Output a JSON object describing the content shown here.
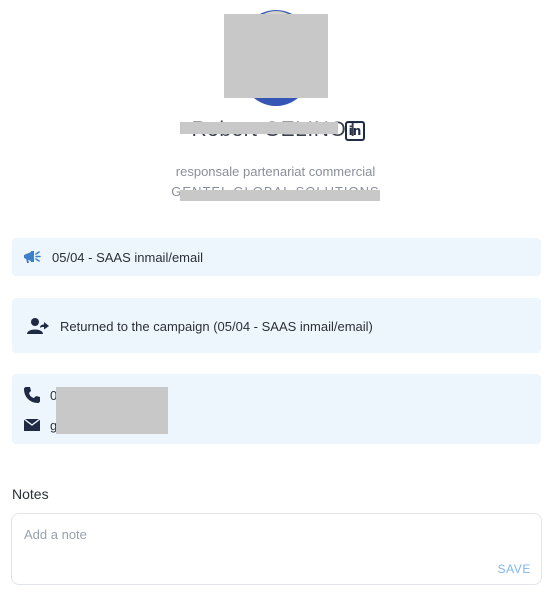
{
  "profile": {
    "name": "Robert GELINOT",
    "role": "responsale partenariat commercial",
    "company": "GENTEL GLOBAL SOLUTIONS",
    "linkedin_label": "in"
  },
  "campaign": {
    "label": "05/04 - SAAS inmail/email"
  },
  "status": {
    "label": "Returned to the campaign (05/04 - SAAS inmail/email)"
  },
  "contact": {
    "phone_prefix": "0",
    "email_prefix": "g"
  },
  "notes": {
    "title": "Notes",
    "placeholder": "Add a note",
    "save_label": "SAVE"
  },
  "colors": {
    "card_bg": "#eef6fd",
    "accent": "#7fb8e8",
    "icon_dark": "#1f2a44"
  }
}
